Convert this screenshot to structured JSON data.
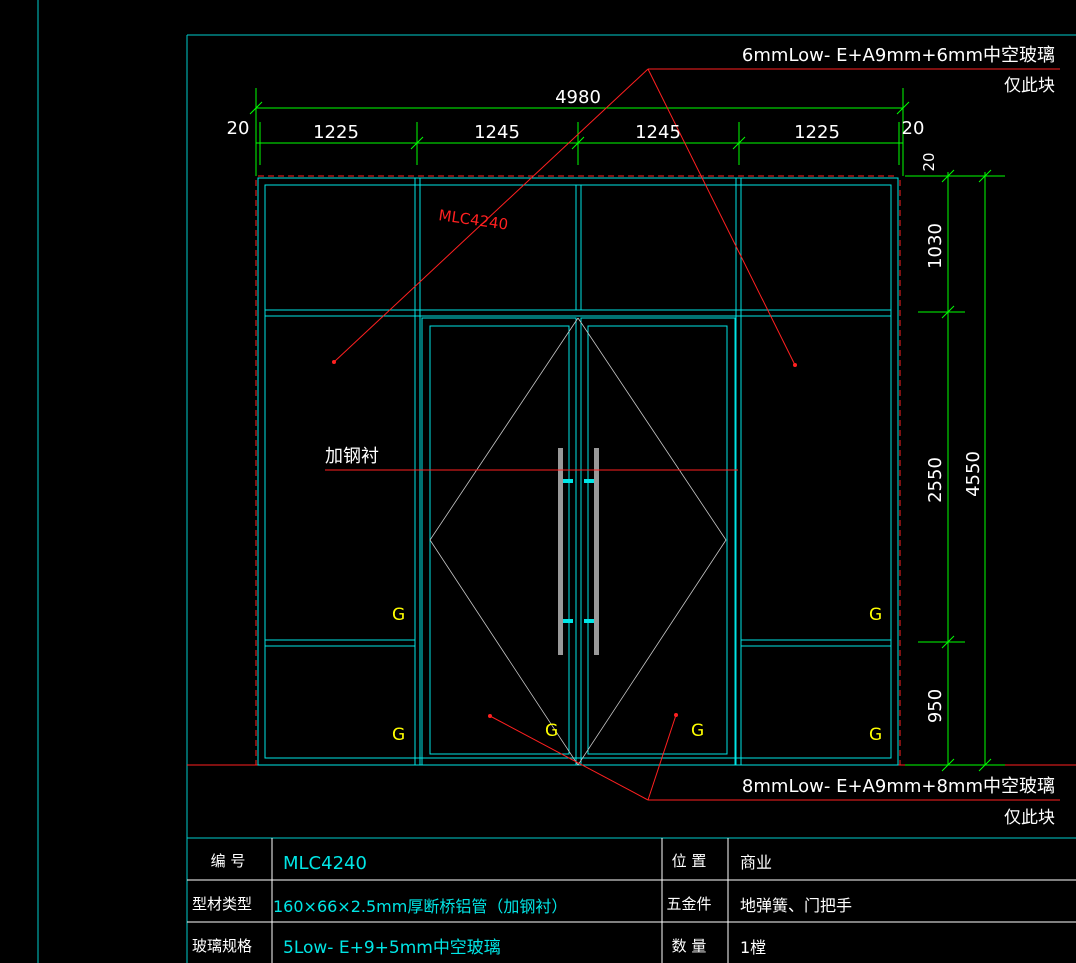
{
  "drawing": {
    "door_code": "MLC4240",
    "reinforce_note": "加钢衬",
    "glass_top": {
      "line1": "6mmLow- E+A9mm+6mm中空玻璃",
      "line2": "仅此块"
    },
    "glass_bottom": {
      "line1": "8mmLow- E+A9mm+8mm中空玻璃",
      "line2": "仅此块"
    },
    "glass_marks": [
      "G",
      "G",
      "G",
      "G",
      "G",
      "G"
    ]
  },
  "dimensions": {
    "total_width": "4980",
    "left_margin": "20",
    "right_margin": "20",
    "top_margin": "20",
    "widths": [
      "1225",
      "1245",
      "1245",
      "1225"
    ],
    "heights": [
      "1030",
      "2550",
      "950"
    ],
    "total_height": "4550"
  },
  "table": {
    "rows": [
      {
        "label": "编  号",
        "value": "MLC4240",
        "label2": "位  置",
        "value2": "商业"
      },
      {
        "label": "型材类型",
        "value": "160×66×2.5mm厚断桥铝管（加钢衬）",
        "label2": "五金件",
        "value2": "地弹簧、门把手"
      },
      {
        "label": "玻璃规格",
        "value": "5Low- E+9+5mm中空玻璃",
        "label2": "数  量",
        "value2": "1樘"
      }
    ]
  },
  "colors": {
    "background": "#000000",
    "frame": "#00e5e5",
    "dimension": "#00ff00",
    "annotation": "#ff2020",
    "label_white": "#ffffff",
    "glass_mark": "#ffff00",
    "handle": "#999999"
  }
}
